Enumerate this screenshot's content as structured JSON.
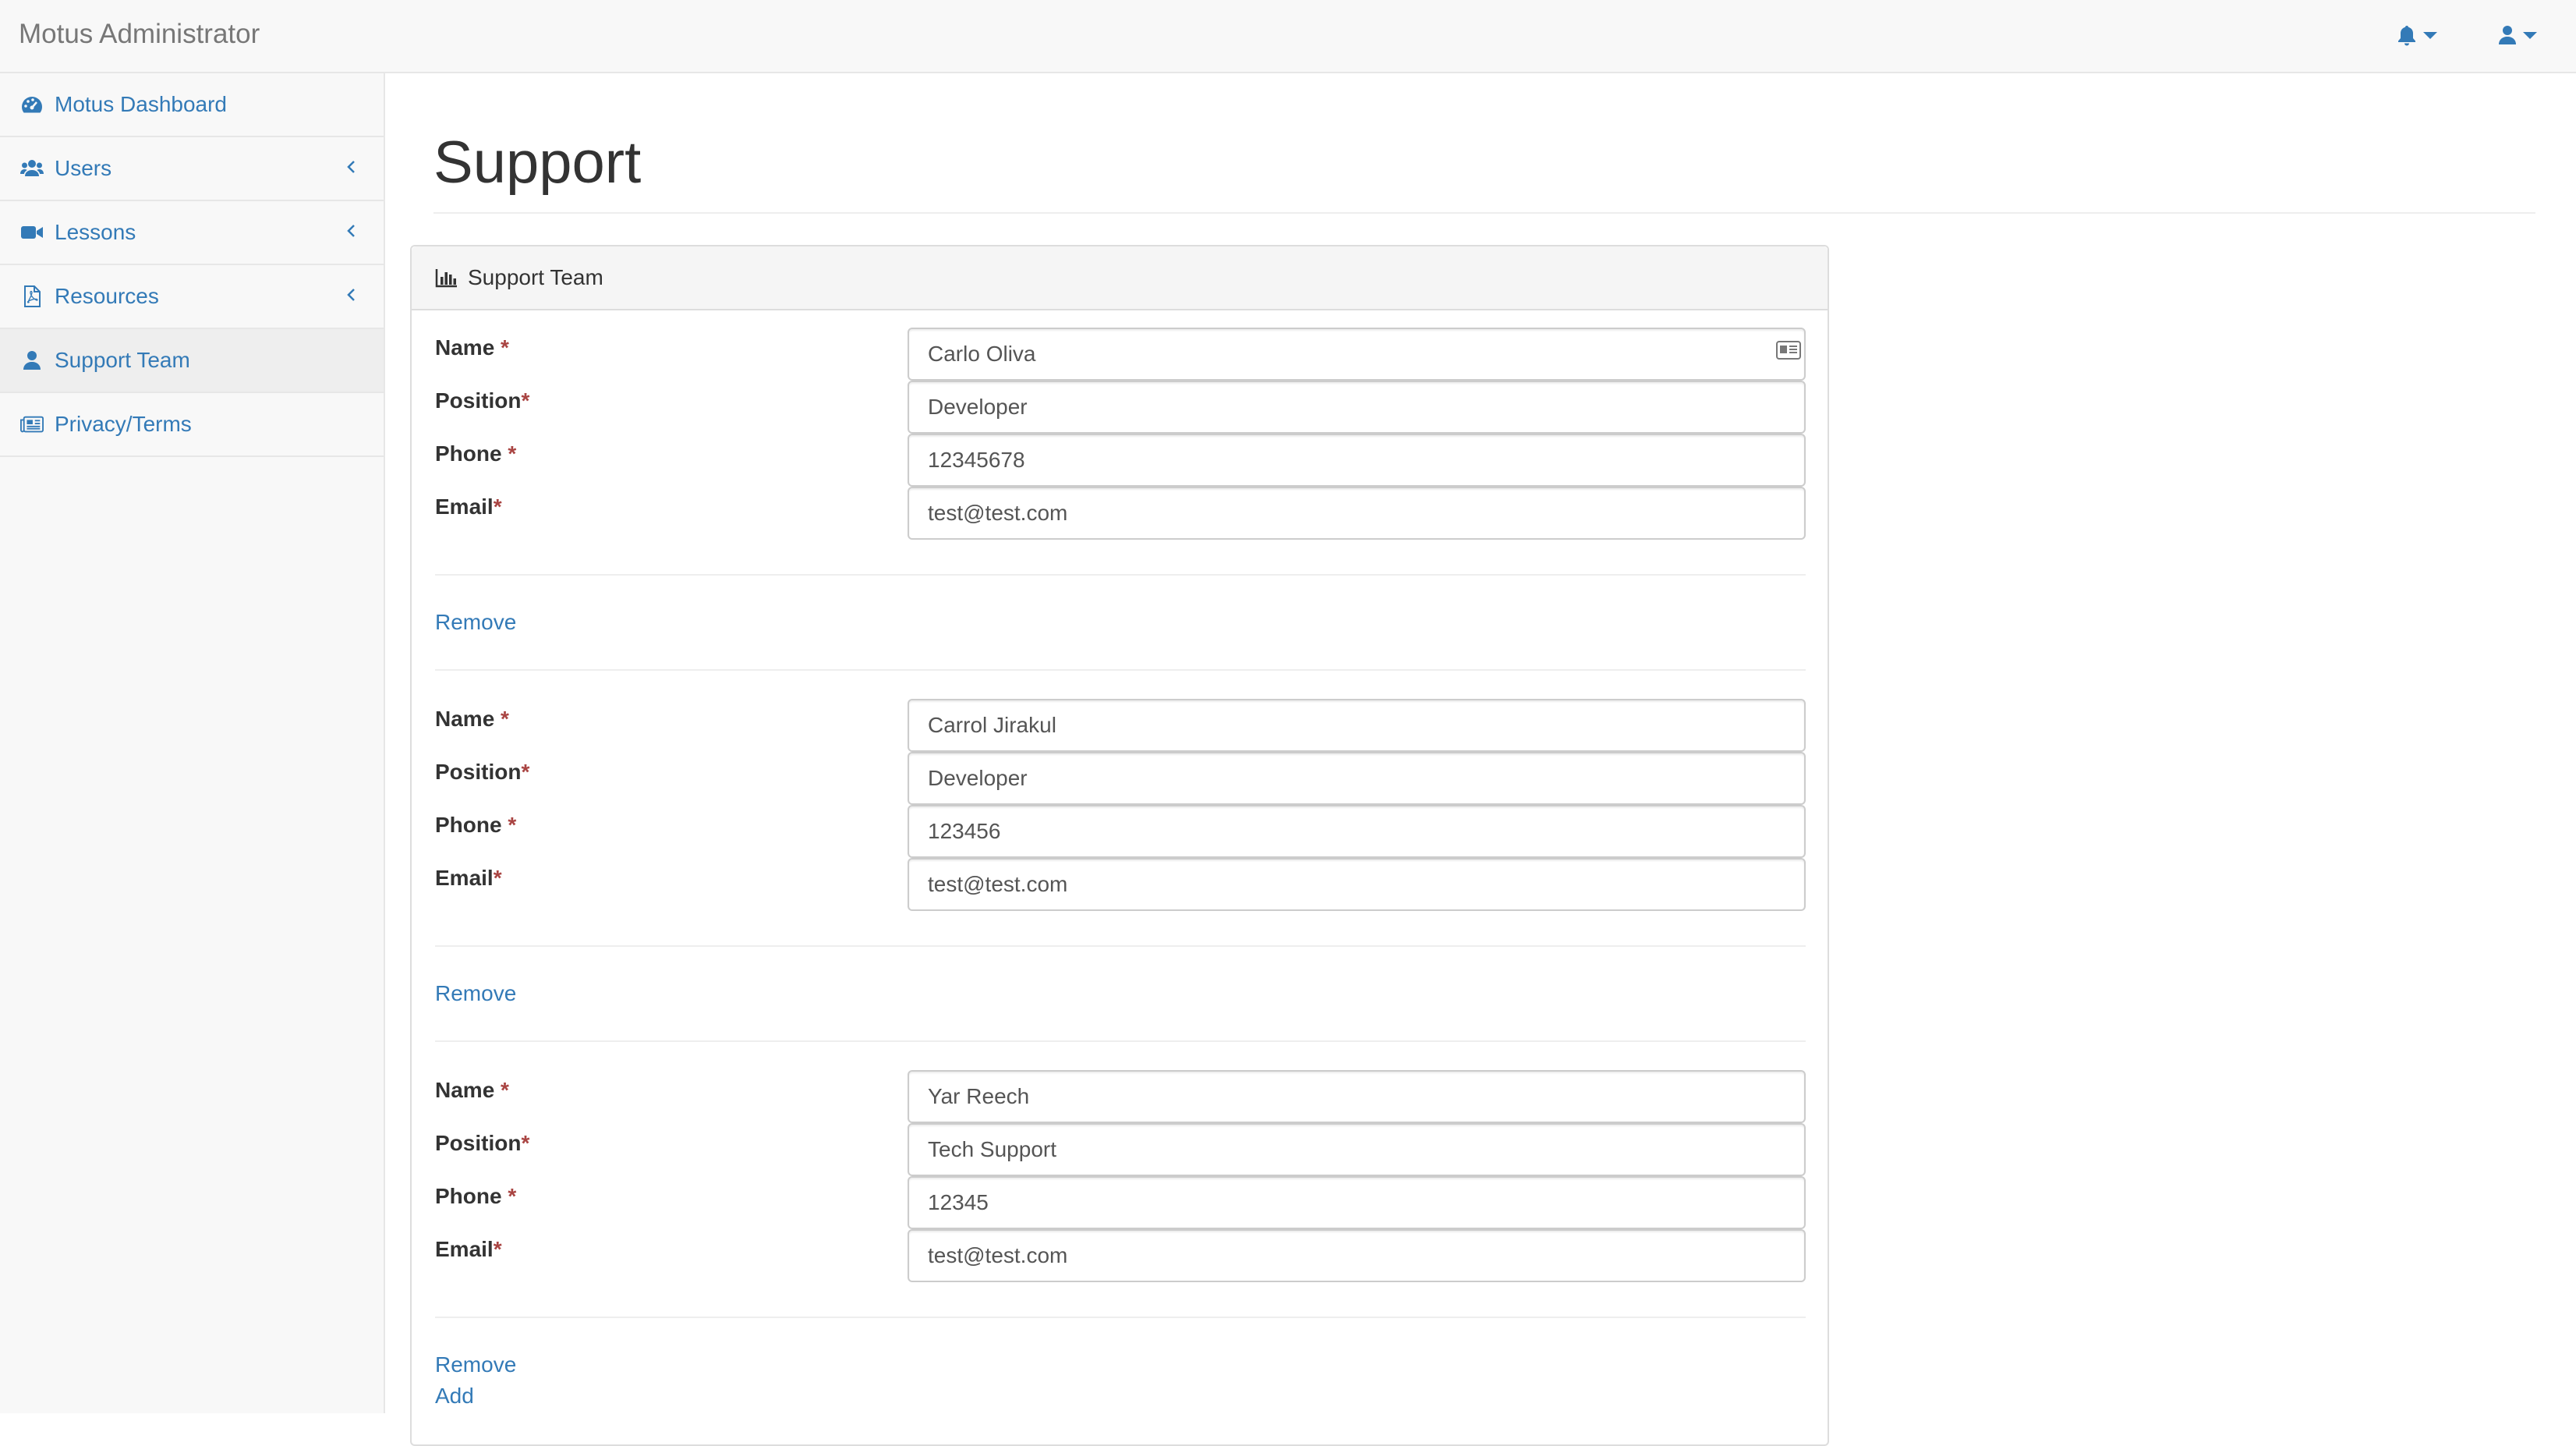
{
  "app": {
    "brand": "Motus Administrator"
  },
  "topbar": {
    "notifications_icon": "bell-icon",
    "user_icon": "user-icon"
  },
  "sidebar": {
    "items": [
      {
        "label": "Motus Dashboard",
        "icon": "dashboard-icon",
        "has_chevron": false,
        "active": false
      },
      {
        "label": "Users",
        "icon": "users-icon",
        "has_chevron": true,
        "active": false
      },
      {
        "label": "Lessons",
        "icon": "video-camera-icon",
        "has_chevron": true,
        "active": false
      },
      {
        "label": "Resources",
        "icon": "pdf-file-icon",
        "has_chevron": true,
        "active": false
      },
      {
        "label": "Support Team",
        "icon": "user-icon",
        "has_chevron": false,
        "active": true
      },
      {
        "label": "Privacy/Terms",
        "icon": "newspaper-icon",
        "has_chevron": false,
        "active": false
      }
    ]
  },
  "page": {
    "title": "Support"
  },
  "panel": {
    "title": "Support Team",
    "icon": "bar-chart-icon",
    "labels": {
      "name": "Name",
      "position": "Position",
      "phone": "Phone",
      "email": "Email",
      "required": "*"
    },
    "members": [
      {
        "name": "Carlo Oliva",
        "position": "Developer",
        "phone": "12345678",
        "email": "test@test.com"
      },
      {
        "name": "Carrol Jirakul",
        "position": "Developer",
        "phone": "123456",
        "email": "test@test.com"
      },
      {
        "name": "Yar Reech",
        "position": "Tech Support",
        "phone": "12345",
        "email": "test@test.com"
      }
    ],
    "remove_label": "Remove",
    "add_label": "Add"
  },
  "colors": {
    "link": "#337ab7",
    "required": "#a94442",
    "sidebar_bg": "#f8f8f8",
    "active_bg": "#eeeeee"
  }
}
